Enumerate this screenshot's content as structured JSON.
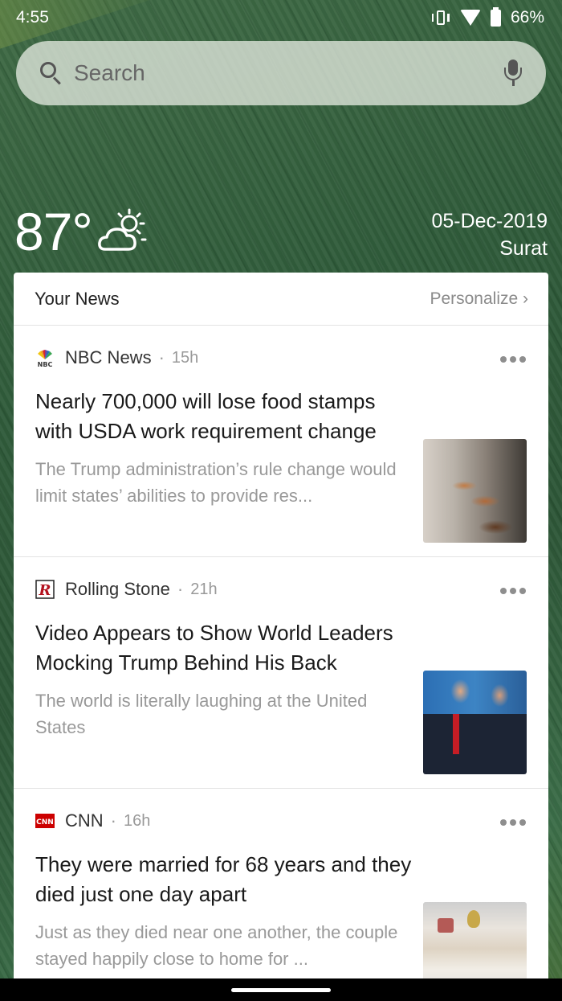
{
  "status_bar": {
    "time": "4:55",
    "battery": "66%",
    "icons": [
      "vibrate-icon",
      "wifi-icon",
      "battery-icon"
    ]
  },
  "search": {
    "placeholder": "Search",
    "icon": "search-icon",
    "mic_icon": "mic-icon"
  },
  "weather": {
    "temperature": "87°",
    "condition_icon": "partly-sunny-icon",
    "date": "05-Dec-2019",
    "location": "Surat"
  },
  "news": {
    "title": "Your News",
    "personalize_label": "Personalize ›",
    "articles": [
      {
        "source": "NBC News",
        "source_icon": "nbc-peacock-icon",
        "age": "15h",
        "headline": "Nearly 700,000 will lose food stamps with USDA work requirement change",
        "summary": "The Trump administration’s rule change would limit states’ abilities to provide res...",
        "thumbnail": "food-serving-thumbnail"
      },
      {
        "source": "Rolling Stone",
        "source_icon": "rolling-stone-icon",
        "age": "21h",
        "headline": "Video Appears to Show World Leaders Mocking Trump Behind His Back",
        "summary": "The world is literally laughing at the United States",
        "thumbnail": "world-leaders-thumbnail"
      },
      {
        "source": "CNN",
        "source_icon": "cnn-icon",
        "age": "16h",
        "headline": "They were married for 68 years and they died just one day apart",
        "summary": "Just as they died near one another, the couple stayed happily close to home for ...",
        "thumbnail": "hospital-room-thumbnail"
      }
    ]
  },
  "colors": {
    "card_background": "#ffffff",
    "muted_text": "#999999",
    "headline_text": "#1a1a1a",
    "cnn_red": "#cc0000"
  }
}
